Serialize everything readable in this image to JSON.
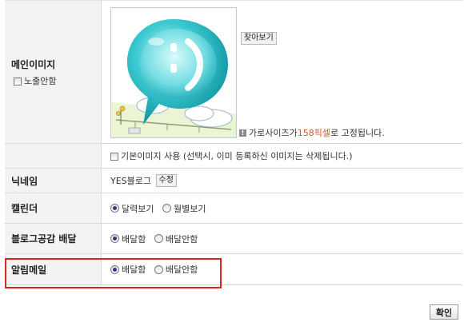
{
  "main_image": {
    "label": "메인이미지",
    "hide_checkbox_label": "노출안함",
    "browse_label": "찾아보기",
    "note_prefix": "가로사이즈가 ",
    "note_highlight": "158픽셀",
    "note_suffix": "로 고정됩니다.",
    "highlight_color": "#e5541f"
  },
  "default_image": {
    "label": "기본이미지 사용 (선택시, 이미 등록하신 이미지는 삭제됩니다.)"
  },
  "nickname": {
    "label": "닉네임",
    "value": "YES블로그",
    "edit_label": "수정"
  },
  "calendar": {
    "label": "캘린더",
    "options": [
      "달력보기",
      "월별보기"
    ],
    "selected": "달력보기"
  },
  "blog_delivery": {
    "label": "블로그공감 배달",
    "options": [
      "배달함",
      "배달안함"
    ],
    "selected": "배달함"
  },
  "alert_mail": {
    "label": "알림메일",
    "options": [
      "배달함",
      "배달안함"
    ],
    "selected": "배달함",
    "outline_color": "#d9241f"
  },
  "confirm_label": "확인"
}
